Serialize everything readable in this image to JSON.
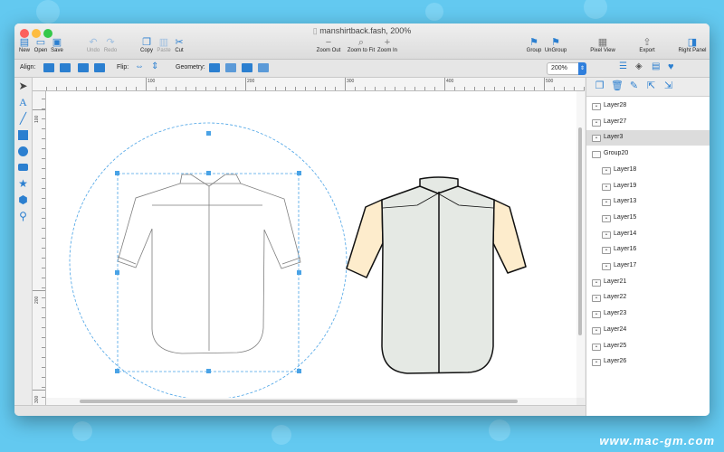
{
  "window": {
    "title": "manshirtback.fash, 200%"
  },
  "toolbar": {
    "new": "New",
    "open": "Open",
    "save": "Save",
    "undo": "Undo",
    "redo": "Redo",
    "copy": "Copy",
    "paste": "Paste",
    "cut": "Cut",
    "zoom_out": "Zoom Out",
    "zoom_fit": "Zoom to Fit",
    "zoom_in": "Zoom In",
    "group": "Group",
    "ungroup": "UnGroup",
    "pixel_view": "Pixel View",
    "export": "Export",
    "right_panel": "Right Panel"
  },
  "optionbar": {
    "align": "Align:",
    "flip": "Flip:",
    "geometry": "Geometry:",
    "zoom_value": "200%"
  },
  "ruler": {
    "h_labels": [
      "100",
      "200",
      "300",
      "400",
      "500"
    ],
    "v_labels": [
      "100",
      "200",
      "300"
    ]
  },
  "layers": [
    {
      "name": "Layer28",
      "indent": false,
      "selected": false,
      "eye": true
    },
    {
      "name": "Layer27",
      "indent": false,
      "selected": false,
      "eye": true
    },
    {
      "name": "Layer3",
      "indent": false,
      "selected": true,
      "eye": true
    },
    {
      "name": "Group20",
      "indent": false,
      "selected": false,
      "eye": false
    },
    {
      "name": "Layer18",
      "indent": true,
      "selected": false,
      "eye": true
    },
    {
      "name": "Layer19",
      "indent": true,
      "selected": false,
      "eye": true
    },
    {
      "name": "Layer13",
      "indent": true,
      "selected": false,
      "eye": true
    },
    {
      "name": "Layer15",
      "indent": true,
      "selected": false,
      "eye": true
    },
    {
      "name": "Layer14",
      "indent": true,
      "selected": false,
      "eye": true
    },
    {
      "name": "Layer16",
      "indent": true,
      "selected": false,
      "eye": true
    },
    {
      "name": "Layer17",
      "indent": true,
      "selected": false,
      "eye": true
    },
    {
      "name": "Layer21",
      "indent": false,
      "selected": false,
      "eye": true
    },
    {
      "name": "Layer22",
      "indent": false,
      "selected": false,
      "eye": true
    },
    {
      "name": "Layer23",
      "indent": false,
      "selected": false,
      "eye": true
    },
    {
      "name": "Layer24",
      "indent": false,
      "selected": false,
      "eye": true
    },
    {
      "name": "Layer25",
      "indent": false,
      "selected": false,
      "eye": true
    },
    {
      "name": "Layer26",
      "indent": false,
      "selected": false,
      "eye": true
    }
  ],
  "colors": {
    "accent": "#2b7fd0",
    "sleeve": "#fdeccc",
    "body": "#e5e9e4",
    "selection": "#4aa3e6"
  },
  "watermark": "www.mac-gm.com"
}
